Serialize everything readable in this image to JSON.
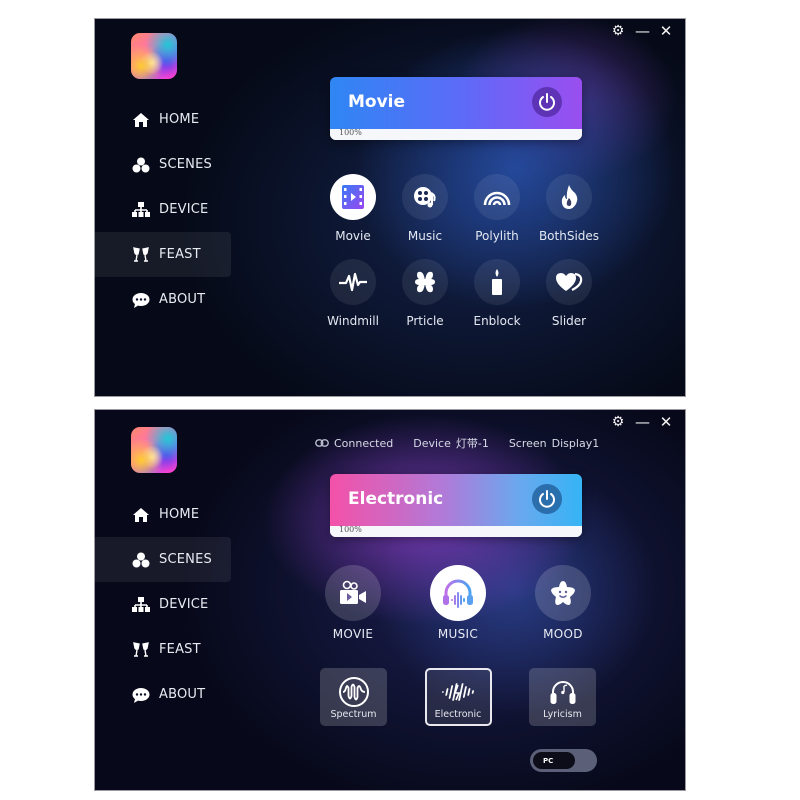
{
  "window_controls": {
    "settings": "gear-icon",
    "minimize": "minimize-icon",
    "close": "close-icon"
  },
  "top_panel": {
    "nav": [
      {
        "label": "HOME",
        "icon": "home-icon",
        "active": false
      },
      {
        "label": "SCENES",
        "icon": "scenes-icon",
        "active": false
      },
      {
        "label": "DEVICE",
        "icon": "device-icon",
        "active": false
      },
      {
        "label": "FEAST",
        "icon": "champagne-icon",
        "active": true
      },
      {
        "label": "ABOUT",
        "icon": "chat-icon",
        "active": false
      }
    ],
    "mode_card": {
      "title": "Movie",
      "progress_label": "100%",
      "progress": 100,
      "gradient": [
        "#2f86f3",
        "#9a4ef0"
      ]
    },
    "effects": [
      {
        "label": "Movie",
        "icon": "film-icon",
        "selected": true
      },
      {
        "label": "Music",
        "icon": "music-disc-icon",
        "selected": false
      },
      {
        "label": "Polylith",
        "icon": "rainbow-icon",
        "selected": false
      },
      {
        "label": "BothSides",
        "icon": "flame-icon",
        "selected": false
      },
      {
        "label": "Windmill",
        "icon": "pulse-icon",
        "selected": false
      },
      {
        "label": "Prticle",
        "icon": "clover-icon",
        "selected": false
      },
      {
        "label": "Enblock",
        "icon": "candle-icon",
        "selected": false
      },
      {
        "label": "Slider",
        "icon": "hearts-icon",
        "selected": false
      }
    ]
  },
  "bottom_panel": {
    "status": {
      "connection": "Connected",
      "device_label": "Device",
      "device_value": "灯带-1",
      "screen_label": "Screen",
      "screen_value": "Display1"
    },
    "nav": [
      {
        "label": "HOME",
        "icon": "home-icon",
        "active": false
      },
      {
        "label": "SCENES",
        "icon": "scenes-icon",
        "active": true
      },
      {
        "label": "DEVICE",
        "icon": "device-icon",
        "active": false
      },
      {
        "label": "FEAST",
        "icon": "champagne-icon",
        "active": false
      },
      {
        "label": "ABOUT",
        "icon": "chat-icon",
        "active": false
      }
    ],
    "mode_card": {
      "title": "Electronic",
      "progress_label": "100%",
      "progress": 100,
      "gradient": [
        "#f451a8",
        "#35b4f5"
      ]
    },
    "categories": [
      {
        "label": "MOVIE",
        "icon": "video-camera-icon",
        "selected": false
      },
      {
        "label": "MUSIC",
        "icon": "headphones-icon",
        "selected": true
      },
      {
        "label": "MOOD",
        "icon": "smiling-star-icon",
        "selected": false
      }
    ],
    "sub_modes": [
      {
        "label": "Spectrum",
        "icon": "waveform-circle-icon",
        "selected": false
      },
      {
        "label": "Electronic",
        "icon": "sound-wave-icon",
        "selected": true
      },
      {
        "label": "Lyricism",
        "icon": "headset-note-icon",
        "selected": false
      }
    ],
    "source_toggle": {
      "label": "PC"
    }
  }
}
